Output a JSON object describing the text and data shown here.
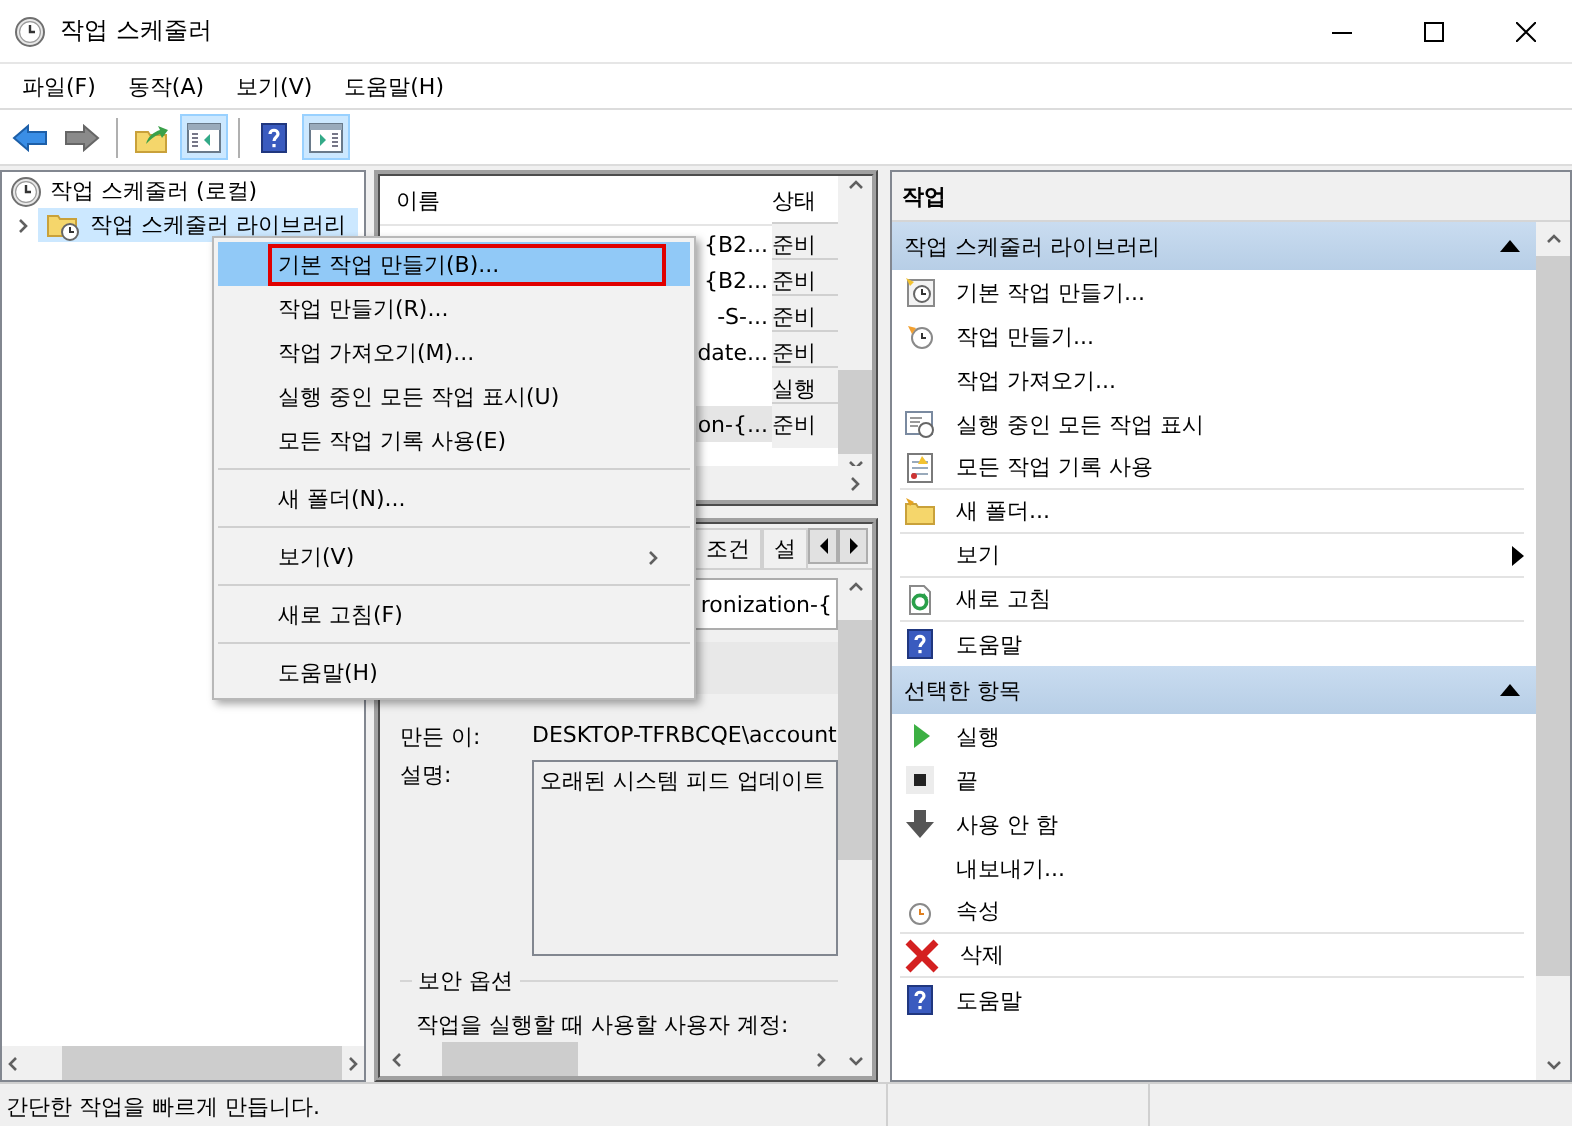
{
  "window": {
    "title": "작업 스케줄러"
  },
  "menu_bar": [
    {
      "label": "파일(F)"
    },
    {
      "label": "동작(A)"
    },
    {
      "label": "보기(V)"
    },
    {
      "label": "도움말(H)"
    }
  ],
  "toolbar": [
    {
      "kind": "back",
      "pressed": false
    },
    {
      "kind": "forward",
      "pressed": false
    },
    {
      "kind": "separator"
    },
    {
      "kind": "up-folder",
      "pressed": false
    },
    {
      "kind": "console-tree",
      "pressed": true
    },
    {
      "kind": "separator"
    },
    {
      "kind": "help",
      "pressed": false
    },
    {
      "kind": "action-pane",
      "pressed": true
    }
  ],
  "tree": [
    {
      "label": "작업 스케줄러 (로컬)",
      "selected": false,
      "children": [
        {
          "label": "작업 스케줄러 라이브러리",
          "selected": true,
          "expanded": false
        }
      ]
    }
  ],
  "task_list": {
    "columns": [
      "이름",
      "상태"
    ],
    "rows": [
      {
        "name": "{B2...",
        "status": "준비",
        "selected": false
      },
      {
        "name": "{B2...",
        "status": "준비",
        "selected": false
      },
      {
        "name": "-S-...",
        "status": "준비",
        "selected": false
      },
      {
        "name": "date...",
        "status": "준비",
        "selected": false
      },
      {
        "name": "",
        "status": "실행",
        "selected": false
      },
      {
        "name": "on-{...",
        "status": "준비",
        "selected": true
      }
    ]
  },
  "details": {
    "tabs": [
      {
        "label": "조건",
        "selected": false
      },
      {
        "label": "설",
        "selected": false
      }
    ],
    "name_value": "ronization-{",
    "author_label": "만든 이:",
    "author": "DESKTOP-TFRBCQE\\account",
    "description_label": "설명:",
    "description": "오래된 시스템 피드 업데이트",
    "security_group": "보안 옵션",
    "account_prompt": "작업을 실행할 때 사용할 사용자 계정:"
  },
  "actions": {
    "title": "작업",
    "sections": [
      {
        "title": "작업 스케줄러 라이브러리",
        "expanded": true,
        "items": [
          {
            "label": "기본 작업 만들기...",
            "kind": "basic-task",
            "submenu": false,
            "divider_after": false
          },
          {
            "label": "작업 만들기...",
            "kind": "task",
            "submenu": false,
            "divider_after": false
          },
          {
            "label": "작업 가져오기...",
            "kind": "plain",
            "submenu": false,
            "divider_after": false
          },
          {
            "label": "실행 중인 모든 작업 표시",
            "kind": "running",
            "submenu": false,
            "divider_after": false
          },
          {
            "label": "모든 작업 기록 사용",
            "kind": "history",
            "submenu": false,
            "divider_after": true
          },
          {
            "label": "새 폴더...",
            "kind": "folder",
            "submenu": false,
            "divider_after": true
          },
          {
            "label": "보기",
            "kind": "plain",
            "submenu": true,
            "divider_after": true
          },
          {
            "label": "새로 고침",
            "kind": "refresh",
            "submenu": false,
            "divider_after": true
          },
          {
            "label": "도움말",
            "kind": "help",
            "submenu": false,
            "divider_after": false
          }
        ]
      },
      {
        "title": "선택한 항목",
        "expanded": true,
        "items": [
          {
            "label": "실행",
            "kind": "run",
            "submenu": false,
            "divider_after": false
          },
          {
            "label": "끝",
            "kind": "stop",
            "submenu": false,
            "divider_after": false
          },
          {
            "label": "사용 안 함",
            "kind": "disable",
            "submenu": false,
            "divider_after": false
          },
          {
            "label": "내보내기...",
            "kind": "plain",
            "submenu": false,
            "divider_after": false
          },
          {
            "label": "속성",
            "kind": "properties",
            "submenu": false,
            "divider_after": true
          },
          {
            "label": "삭제",
            "kind": "delete",
            "submenu": false,
            "divider_after": true
          },
          {
            "label": "도움말",
            "kind": "help",
            "submenu": false,
            "divider_after": false
          }
        ]
      }
    ]
  },
  "context_menu": [
    {
      "kind": "item",
      "label": "기본 작업 만들기(B)...",
      "selected": true,
      "marked": true
    },
    {
      "kind": "item",
      "label": "작업 만들기(R)...",
      "selected": false,
      "marked": false
    },
    {
      "kind": "item",
      "label": "작업 가져오기(M)...",
      "selected": false,
      "marked": false
    },
    {
      "kind": "item",
      "label": "실행 중인 모든 작업 표시(U)",
      "selected": false,
      "marked": false
    },
    {
      "kind": "item",
      "label": "모든 작업 기록 사용(E)",
      "selected": false,
      "marked": false
    },
    {
      "kind": "separator"
    },
    {
      "kind": "item",
      "label": "새 폴더(N)...",
      "selected": false,
      "marked": false
    },
    {
      "kind": "separator"
    },
    {
      "kind": "submenu",
      "label": "보기(V)",
      "selected": false,
      "marked": false
    },
    {
      "kind": "separator"
    },
    {
      "kind": "item",
      "label": "새로 고침(F)",
      "selected": false,
      "marked": false
    },
    {
      "kind": "separator"
    },
    {
      "kind": "item",
      "label": "도움말(H)",
      "selected": false,
      "marked": false
    }
  ],
  "status_bar": {
    "text": "간단한 작업을 빠르게 만듭니다."
  }
}
